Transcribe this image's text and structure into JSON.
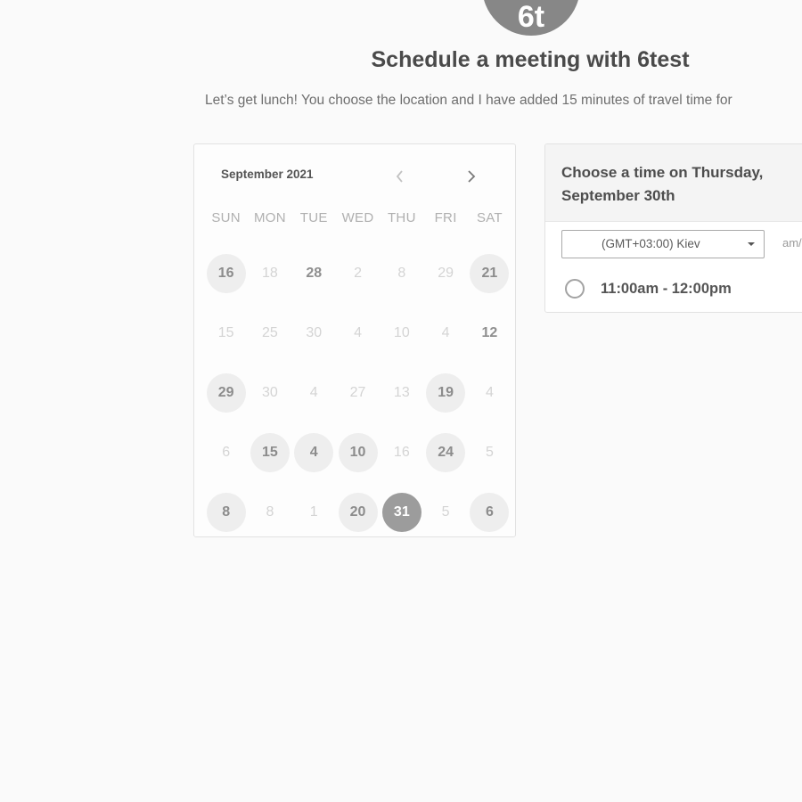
{
  "header": {
    "avatar_initials": "6t",
    "title": "Schedule a meeting with 6test",
    "subtitle": "Let’s get lunch! You choose the location and I have added 15 minutes of travel time for"
  },
  "calendar": {
    "month_label": "September 2021",
    "prev_icon": "chevron-left-icon",
    "next_icon": "chevron-right-icon",
    "weekdays": [
      "SUN",
      "MON",
      "TUE",
      "WED",
      "THU",
      "FRI",
      "SAT"
    ],
    "weeks": [
      [
        {
          "label": "16",
          "state": "available"
        },
        {
          "label": "18",
          "state": "disabled"
        },
        {
          "label": "28",
          "state": "bold"
        },
        {
          "label": "2",
          "state": "disabled"
        },
        {
          "label": "8",
          "state": "disabled"
        },
        {
          "label": "29",
          "state": "disabled"
        },
        {
          "label": "21",
          "state": "available"
        }
      ],
      [
        {
          "label": "15",
          "state": "disabled"
        },
        {
          "label": "25",
          "state": "disabled"
        },
        {
          "label": "30",
          "state": "disabled"
        },
        {
          "label": "4",
          "state": "disabled"
        },
        {
          "label": "10",
          "state": "disabled"
        },
        {
          "label": "4",
          "state": "disabled"
        },
        {
          "label": "12",
          "state": "bold"
        }
      ],
      [
        {
          "label": "29",
          "state": "available"
        },
        {
          "label": "30",
          "state": "disabled"
        },
        {
          "label": "4",
          "state": "disabled"
        },
        {
          "label": "27",
          "state": "disabled"
        },
        {
          "label": "13",
          "state": "disabled"
        },
        {
          "label": "19",
          "state": "available"
        },
        {
          "label": "4",
          "state": "disabled"
        }
      ],
      [
        {
          "label": "6",
          "state": "disabled"
        },
        {
          "label": "15",
          "state": "available"
        },
        {
          "label": "4",
          "state": "available"
        },
        {
          "label": "10",
          "state": "available"
        },
        {
          "label": "16",
          "state": "disabled"
        },
        {
          "label": "24",
          "state": "available"
        },
        {
          "label": "5",
          "state": "disabled"
        }
      ],
      [
        {
          "label": "8",
          "state": "available"
        },
        {
          "label": "8",
          "state": "disabled"
        },
        {
          "label": "1",
          "state": "disabled"
        },
        {
          "label": "20",
          "state": "available"
        },
        {
          "label": "31",
          "state": "selected"
        },
        {
          "label": "5",
          "state": "disabled"
        },
        {
          "label": "6",
          "state": "available"
        }
      ]
    ]
  },
  "time_panel": {
    "heading": "Choose a time on Thursday, September 30th",
    "timezone": "(GMT+03:00) Kiev",
    "format_toggle": "am/pm",
    "slots": [
      {
        "label": "11:00am - 12:00pm",
        "selected": false
      }
    ]
  },
  "colors": {
    "background": "#fafafa",
    "avatar": "#878787",
    "selected_day": "#9c9c9c",
    "available_day": "#eeeeee"
  }
}
